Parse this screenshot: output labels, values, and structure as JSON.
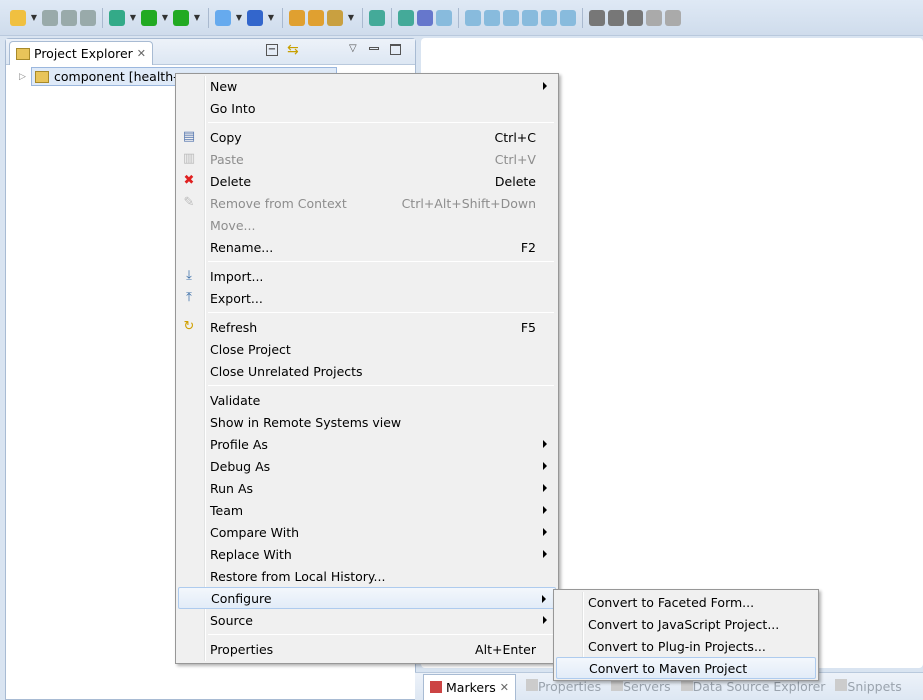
{
  "toolbar": {
    "icons": [
      "new-wizard-icon",
      "save-icon",
      "save-all-icon",
      "print-icon",
      "debug-icon",
      "run-icon",
      "run-external-icon",
      "new-server-icon",
      "new-web-service-icon",
      "open-type-icon",
      "open-resource-icon",
      "search-icon",
      "web-browser-icon",
      "deploy-icon",
      "pin-icon",
      "resume-icon",
      "suspend-icon",
      "terminate-icon",
      "disconnect-icon",
      "step-into-icon",
      "step-over-icon",
      "step-return-icon",
      "annotation-next-icon",
      "annotation-prev-icon",
      "last-edit-icon",
      "back-icon",
      "forward-icon"
    ]
  },
  "explorer": {
    "tab_label": "Project Explorer",
    "tree_item": "component [health-w"
  },
  "context_menu": [
    {
      "label": "New",
      "submenu": true
    },
    {
      "label": "Go Into"
    },
    {
      "sep": true
    },
    {
      "label": "Copy",
      "shortcut": "Ctrl+C",
      "icon": "copy-icon"
    },
    {
      "label": "Paste",
      "shortcut": "Ctrl+V",
      "icon": "paste-icon",
      "disabled": true
    },
    {
      "label": "Delete",
      "shortcut": "Delete",
      "icon": "delete-icon"
    },
    {
      "label": "Remove from Context",
      "shortcut": "Ctrl+Alt+Shift+Down",
      "icon": "remove-context-icon",
      "disabled": true
    },
    {
      "label": "Move...",
      "disabled": true
    },
    {
      "label": "Rename...",
      "shortcut": "F2"
    },
    {
      "sep": true
    },
    {
      "label": "Import...",
      "icon": "import-icon"
    },
    {
      "label": "Export...",
      "icon": "export-icon"
    },
    {
      "sep": true
    },
    {
      "label": "Refresh",
      "shortcut": "F5",
      "icon": "refresh-icon"
    },
    {
      "label": "Close Project"
    },
    {
      "label": "Close Unrelated Projects"
    },
    {
      "sep": true
    },
    {
      "label": "Validate"
    },
    {
      "label": "Show in Remote Systems view"
    },
    {
      "label": "Profile As",
      "submenu": true
    },
    {
      "label": "Debug As",
      "submenu": true
    },
    {
      "label": "Run As",
      "submenu": true
    },
    {
      "label": "Team",
      "submenu": true
    },
    {
      "label": "Compare With",
      "submenu": true
    },
    {
      "label": "Replace With",
      "submenu": true
    },
    {
      "label": "Restore from Local History..."
    },
    {
      "label": "Configure",
      "submenu": true,
      "highlighted": true
    },
    {
      "label": "Source",
      "submenu": true
    },
    {
      "sep": true
    },
    {
      "label": "Properties",
      "shortcut": "Alt+Enter"
    }
  ],
  "configure_submenu": [
    {
      "label": "Convert to Faceted Form..."
    },
    {
      "label": "Convert to JavaScript Project..."
    },
    {
      "label": "Convert to Plug-in Projects..."
    },
    {
      "label": "Convert to Maven Project",
      "highlighted": true
    }
  ],
  "bottom_tabs": [
    "Markers",
    "Properties",
    "Servers",
    "Data Source Explorer",
    "Snippets"
  ]
}
